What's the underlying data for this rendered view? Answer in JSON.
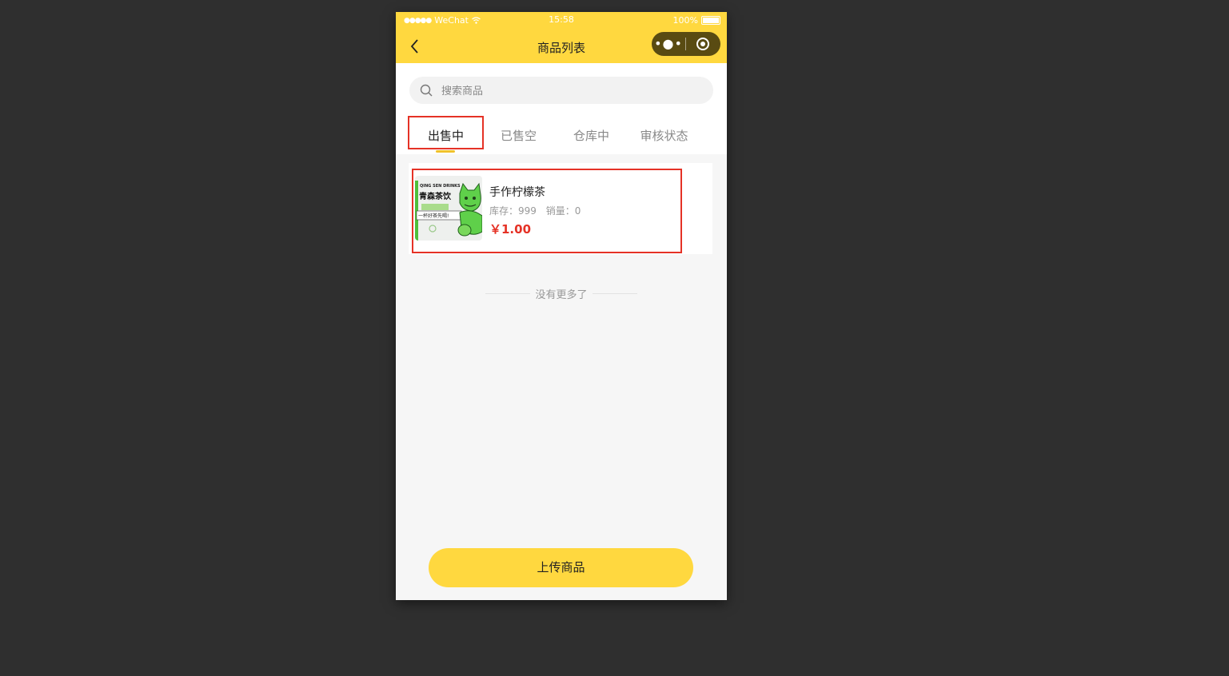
{
  "status_bar": {
    "carrier": "WeChat",
    "time": "15:58",
    "battery": "100%"
  },
  "nav": {
    "title": "商品列表"
  },
  "search": {
    "placeholder": "搜索商品"
  },
  "tabs": [
    {
      "label": "出售中",
      "active": true
    },
    {
      "label": "已售空",
      "active": false
    },
    {
      "label": "仓库中",
      "active": false
    },
    {
      "label": "审核状态",
      "active": false
    }
  ],
  "products": [
    {
      "name": "手作柠檬茶",
      "stock_label": "库存：999",
      "sales_label": "销量：0",
      "price": "￥1.00",
      "image_text": {
        "brand_en": "QING SEN DRINKS",
        "brand_cn": "青森茶饮",
        "slogan": "一杯好茶先喝!"
      }
    }
  ],
  "list_footer": "没有更多了",
  "upload_button": "上传商品",
  "colors": {
    "accent": "#ffd83f",
    "price": "#e53226",
    "highlight_box": "#e53226",
    "tab_underline": "#f1c12a"
  }
}
